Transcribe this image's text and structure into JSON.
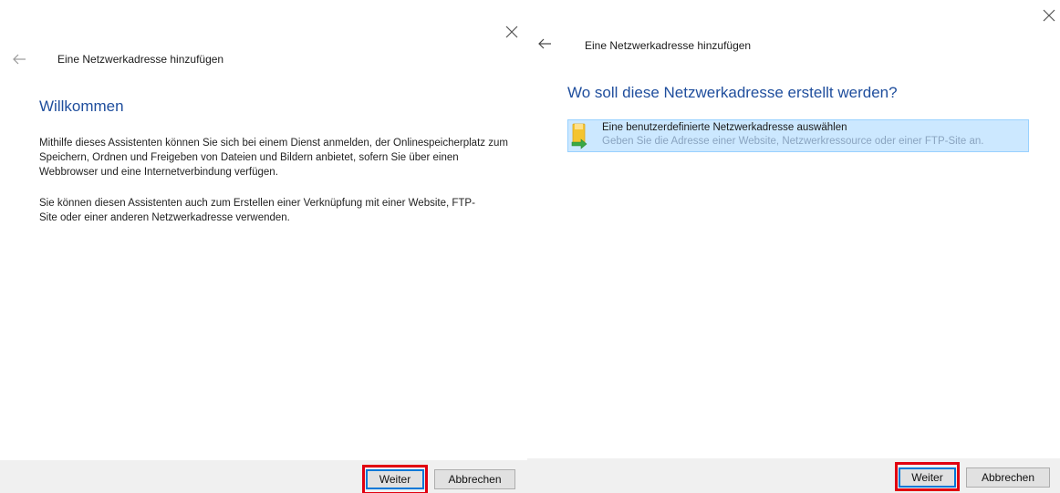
{
  "left_panel": {
    "close_icon": "close-icon",
    "back_icon": "back-arrow-icon",
    "wizard_title": "Eine Netzwerkadresse hinzufügen",
    "heading": "Willkommen",
    "paragraph_1": "Mithilfe dieses Assistenten können Sie sich bei einem Dienst anmelden, der Onlinespeicherplatz zum Speichern, Ordnen und Freigeben von Dateien und Bildern anbietet, sofern Sie über einen Webbrowser und eine Internetverbindung verfügen.",
    "paragraph_2": "Sie können diesen Assistenten auch zum Erstellen einer Verknüpfung mit einer Website, FTP-Site oder einer anderen Netzwerkadresse verwenden.",
    "next_label": "Weiter",
    "cancel_label": "Abbrechen"
  },
  "right_panel": {
    "close_icon": "close-icon",
    "back_icon": "back-arrow-icon",
    "wizard_title": "Eine Netzwerkadresse hinzufügen",
    "heading": "Wo soll diese Netzwerkadresse erstellt werden?",
    "options": [
      {
        "icon": "network-folder-icon",
        "label": "Eine benutzerdefinierte Netzwerkadresse auswählen",
        "description": "Geben Sie die Adresse einer Website, Netzwerkressource oder einer FTP-Site an."
      }
    ],
    "next_label": "Weiter",
    "cancel_label": "Abbrechen"
  },
  "colors": {
    "heading": "#1f4e9d",
    "selection_bg": "#cce8ff",
    "selection_border": "#99d1ff",
    "highlight": "#e10010",
    "footer_bg": "#f0f0f0"
  }
}
